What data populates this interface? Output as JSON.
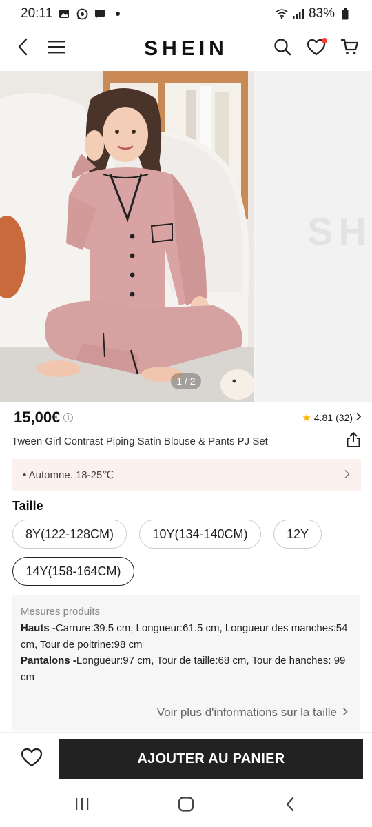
{
  "status_bar": {
    "time": "20:11",
    "battery": "83%",
    "icons": [
      "gallery-icon",
      "whatsapp-icon",
      "chat-icon",
      "wifi-icon",
      "signal-icon",
      "battery-icon"
    ]
  },
  "header": {
    "logo": "SHEIN",
    "icons": [
      "back-arrow-icon",
      "menu-icon",
      "search-icon",
      "heart-icon",
      "cart-icon"
    ]
  },
  "gallery": {
    "counter": "1 / 2",
    "next_watermark": "SH"
  },
  "product": {
    "price": "15,00€",
    "info_icon_glyph": "i",
    "rating": "4.81",
    "review_count": "(32)",
    "title": "Tween Girl Contrast Piping Satin Blouse & Pants PJ Set"
  },
  "season_banner": {
    "text": "• Automne. 18-25℃"
  },
  "sizes": {
    "title": "Taille",
    "options": [
      "8Y(122-128CM)",
      "10Y(134-140CM)",
      "12Y",
      "14Y(158-164CM)"
    ],
    "selected": "14Y(158-164CM)"
  },
  "measurements": {
    "heading": "Mesures produits",
    "hauts_label": "Hauts -",
    "hauts_text": "Carrure:39.5 cm,   Longueur:61.5 cm,   Longueur des manches:54 cm,   Tour de poitrine:98 cm",
    "pantalons_label": "Pantalons -",
    "pantalons_text": "Longueur:97 cm,   Tour de taille:68 cm,   Tour de hanches: 99 cm",
    "more_info": "Voir plus d'informations sur la taille"
  },
  "actions": {
    "add_to_cart": "AJOUTER AU PANIER"
  },
  "colors": {
    "accent_dark": "#222222",
    "banner_bg": "#fdf1ef",
    "star": "#fbb100",
    "notification_dot": "#ff3b30",
    "pajama_pink": "#d9a3a3"
  }
}
